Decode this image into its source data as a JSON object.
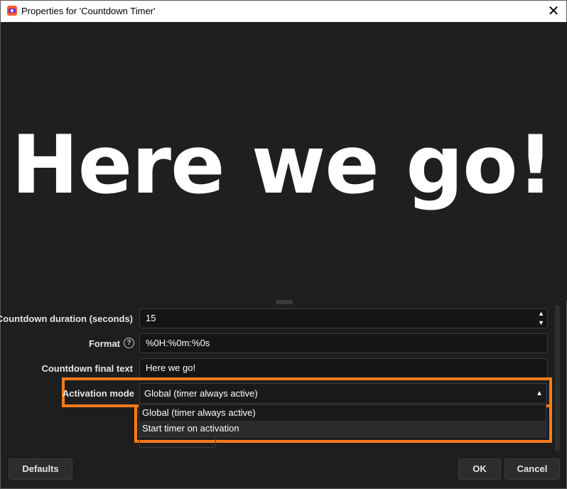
{
  "window": {
    "title": "Properties for 'Countdown Timer'",
    "close_glyph": "✕",
    "app_icon": "obs-app-icon"
  },
  "preview": {
    "text": "Here we go!"
  },
  "form": {
    "duration": {
      "label": "Countdown duration (seconds)",
      "value": "15",
      "up_glyph": "▲",
      "down_glyph": "▼"
    },
    "format": {
      "label": "Format",
      "value": "%0H:%0m:%0s",
      "help_glyph": "?"
    },
    "final_text": {
      "label": "Countdown final text",
      "value": "Here we go!"
    },
    "activation": {
      "label": "Activation mode",
      "selected": "Global (timer always active)",
      "arrow_glyph": "▲",
      "options": [
        "Global (timer always active)",
        "Start timer on activation"
      ]
    }
  },
  "buttons": {
    "defaults": "Defaults",
    "ok": "OK",
    "cancel": "Cancel"
  },
  "colors": {
    "highlight": "#ff7a1a",
    "background": "#1e1e1e",
    "preview_text": "#ffffff"
  }
}
